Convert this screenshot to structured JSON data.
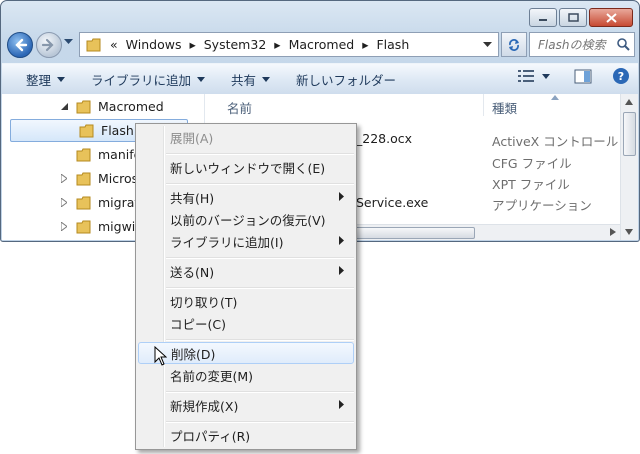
{
  "colors": {
    "titlebar": "#c6d8ea",
    "selection": "#d5e7fa",
    "menu_bg": "#f0f0f0",
    "disabled_text": "#8d8d8d"
  },
  "window": {
    "caption_buttons": [
      "minimize-icon",
      "maximize-icon",
      "close-icon"
    ]
  },
  "address": {
    "overflow": "«",
    "crumbs": [
      "Windows",
      "System32",
      "Macromed",
      "Flash"
    ],
    "search_placeholder": "Flashの検索"
  },
  "toolbar": {
    "organize": "整理",
    "add_to_library": "ライブラリに追加",
    "share": "共有",
    "new_folder": "新しいフォルダー"
  },
  "tree": {
    "items": [
      "Macromed",
      "Flash",
      "manifes",
      "Microsof",
      "migratio",
      "migwiz"
    ]
  },
  "list": {
    "col_name": "名前",
    "col_type": "種類",
    "rows": [
      {
        "name": "_228.ocx",
        "type": "ActiveX コントロール"
      },
      {
        "name": "",
        "type": "CFG ファイル"
      },
      {
        "name": "",
        "type": "XPT ファイル"
      },
      {
        "name": "Service.exe",
        "type": "アプリケーション"
      }
    ]
  },
  "context_menu": {
    "items": [
      {
        "label": "展開(A)",
        "disabled": true
      },
      {
        "label": "新しいウィンドウで開く(E)"
      },
      {
        "label": "共有(H)",
        "submenu": true
      },
      {
        "label": "以前のバージョンの復元(V)"
      },
      {
        "label": "ライブラリに追加(I)",
        "submenu": true
      },
      {
        "label": "送る(N)",
        "submenu": true
      },
      {
        "label": "切り取り(T)"
      },
      {
        "label": "コピー(C)"
      },
      {
        "label": "削除(D)",
        "highlighted": true
      },
      {
        "label": "名前の変更(M)"
      },
      {
        "label": "新規作成(X)",
        "submenu": true
      },
      {
        "label": "プロパティ(R)"
      }
    ]
  }
}
